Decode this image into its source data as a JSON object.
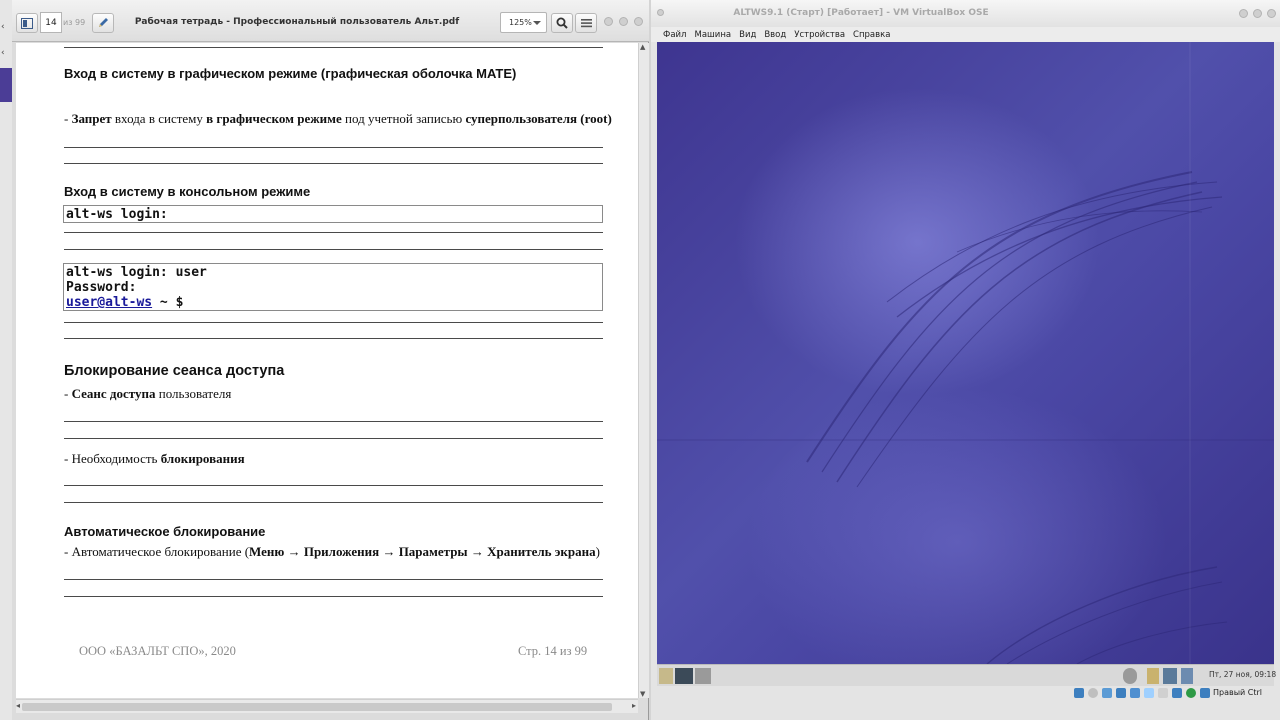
{
  "pdf_viewer": {
    "title": "Рабочая тетрадь - Профессиональный пользователь Альт.pdf",
    "page_current": "14",
    "page_of": "из 99",
    "zoom": "125%",
    "page": {
      "h_graphical": "Вход в систему в графическом режиме (графическая оболочка MATE)",
      "p_forbid": {
        "dash": "- ",
        "b1": "Запрет",
        "t1": " входа в систему ",
        "b2": "в графическом режиме",
        "t2": " под учетной записью ",
        "b3": "суперпользователя (root)"
      },
      "h_console": "Вход в систему в консольном режиме",
      "term1_line": "alt-ws login:",
      "term2": {
        "line1": "alt-ws login: user",
        "line2": "Password:",
        "prompt_link": "user@alt-ws",
        "prompt_rest": " ~ $"
      },
      "h_lock": "Блокирование сеанса доступа",
      "p_session": {
        "dash": "- ",
        "b": "Сеанс доступа",
        "t": " пользователя"
      },
      "p_need": {
        "t": "- Необходимость ",
        "b": "блокирования"
      },
      "h_auto": "Автоматическое блокирование",
      "p_auto": {
        "t1": "- Автоматическое блокирование (",
        "b1": "Меню",
        "a1": " → ",
        "b2": "Приложения",
        "a2": " → ",
        "b3": "Параметры",
        "a3": " → ",
        "b4": "Хранитель экрана",
        "t2": ")"
      },
      "footer_left": "ООО «БАЗАЛЬТ СПО», 2020",
      "footer_right": "Стр. 14 из 99"
    }
  },
  "virtualbox": {
    "title": "ALTWS9.1 (Старт) [Работает] - VM VirtualBox OSE",
    "menu": [
      "Файл",
      "Машина",
      "Вид",
      "Ввод",
      "Устройства",
      "Справка"
    ],
    "guest_clock": "Пт, 27 ноя, 09:18",
    "host_key": "Правый Ctrl",
    "accent_color": "#4a47a4"
  }
}
